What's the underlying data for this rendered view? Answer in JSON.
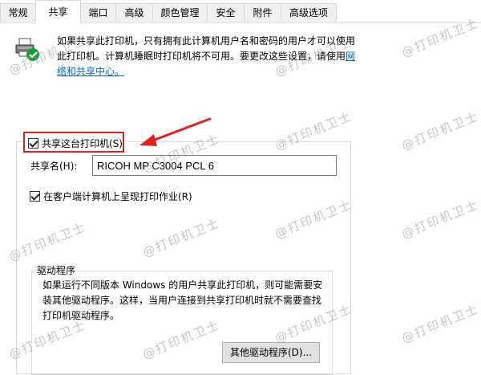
{
  "tabs": [
    "常规",
    "共享",
    "端口",
    "高级",
    "颜色管理",
    "安全",
    "附件",
    "高级选项"
  ],
  "active_tab": "共享",
  "sharing_desc": "如果共享此打印机，只有拥有此计算机用户名和密码的用户才可以使用此打印机。计算机睡眠时打印机将不可用。要更改这些设置，请使用",
  "network_link": "网络和共享中心。",
  "share_checkbox": {
    "label": "共享这台打印机(S)",
    "checked": true
  },
  "share_name": {
    "label": "共享名(H):",
    "value": "RICOH MP C3004 PCL 6"
  },
  "render_checkbox": {
    "label": "在客户端计算机上呈现打印作业(R)",
    "checked": true
  },
  "drivers": {
    "title": "驱动程序",
    "description": "如果运行不同版本 Windows 的用户共享此打印机，则可能需要安装其他驱动程序。这样，当用户连接到共享打印机时就不需要查找打印机驱动程序。",
    "button": "其他驱动程序(D)..."
  },
  "watermark": "@打印机卫士",
  "annotation_color": "#e0221d",
  "icons": [
    "printer-share-icon",
    "check-icon",
    "red-arrow-icon"
  ]
}
